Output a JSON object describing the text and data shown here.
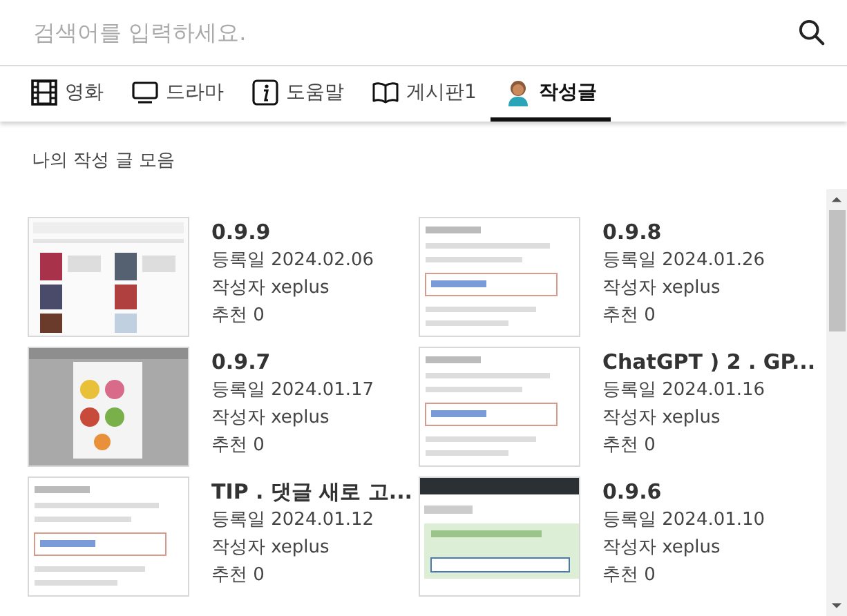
{
  "search": {
    "placeholder": "검색어를 입력하세요."
  },
  "tabs": [
    {
      "label": "영화",
      "selected": false
    },
    {
      "label": "드라마",
      "selected": false
    },
    {
      "label": "도움말",
      "selected": false
    },
    {
      "label": "게시판1",
      "selected": false
    },
    {
      "label": "작성글",
      "selected": true
    }
  ],
  "heading": "나의 작성 글 모음",
  "posts": [
    {
      "title": "0.9.9",
      "date": "등록일 2024.02.06",
      "author": "작성자 xeplus",
      "likes": "추천 0"
    },
    {
      "title": "0.9.8",
      "date": "등록일 2024.01.26",
      "author": "작성자 xeplus",
      "likes": "추천 0"
    },
    {
      "title": "0.9.7",
      "date": "등록일 2024.01.17",
      "author": "작성자 xeplus",
      "likes": "추천 0"
    },
    {
      "title": "ChatGPT ) 2 . GP...",
      "date": "등록일 2024.01.16",
      "author": "작성자 xeplus",
      "likes": "추천 0"
    },
    {
      "title": "TIP . 댓글 새로 고...",
      "date": "등록일 2024.01.12",
      "author": "작성자 xeplus",
      "likes": "추천 0"
    },
    {
      "title": "0.9.6",
      "date": "등록일 2024.01.10",
      "author": "작성자 xeplus",
      "likes": "추천 0"
    }
  ]
}
